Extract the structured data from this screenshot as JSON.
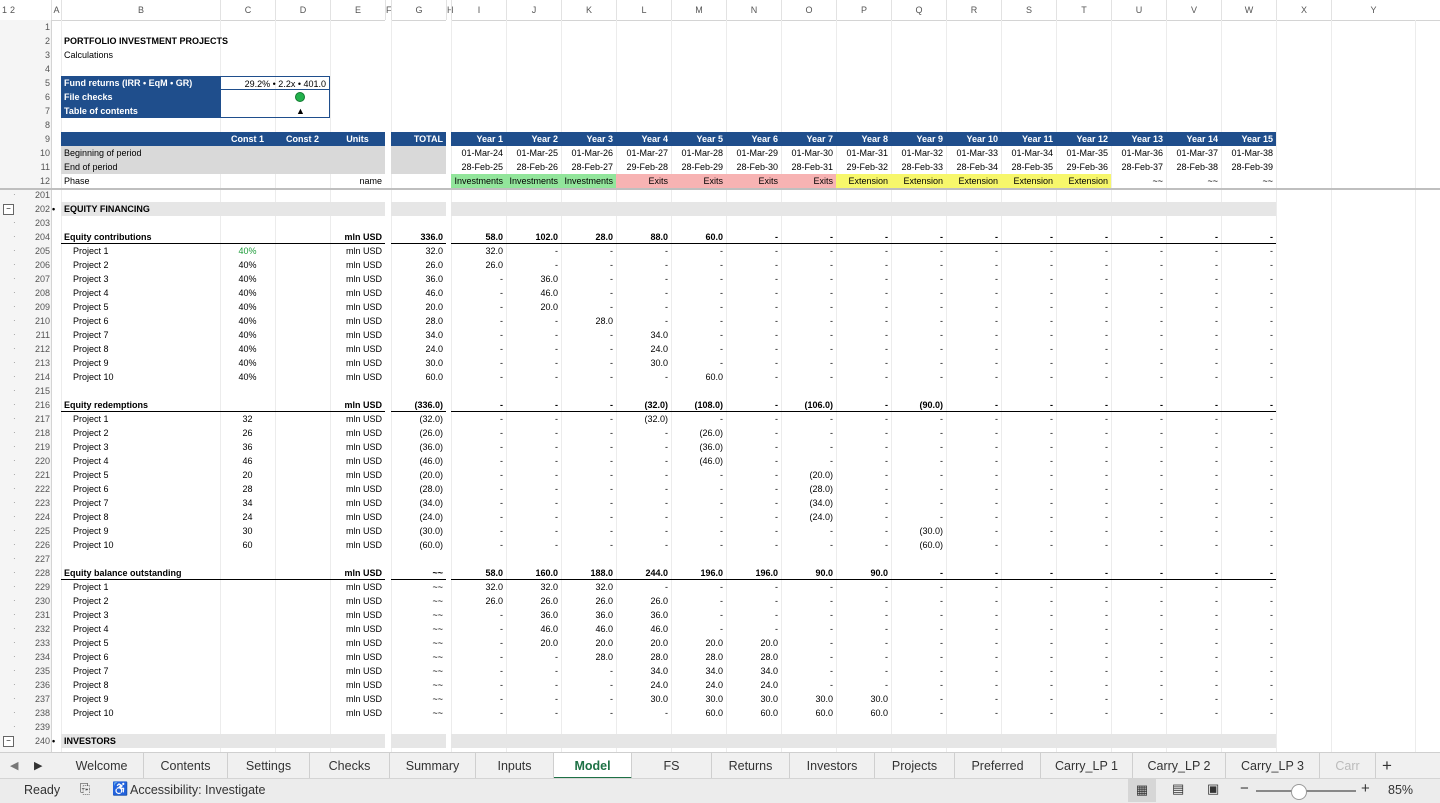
{
  "col_headers": [
    "A",
    "B",
    "C",
    "D",
    "E",
    "F",
    "G",
    "H",
    "I",
    "J",
    "K",
    "L",
    "M",
    "N",
    "O",
    "P",
    "Q",
    "R",
    "S",
    "T",
    "U",
    "V",
    "W",
    "X",
    "Y"
  ],
  "outline_levels": [
    "1",
    "2"
  ],
  "top": {
    "title": "PORTFOLIO INVESTMENT PROJECTS",
    "subtitle": "Calculations",
    "fund_label": "Fund returns (IRR • EqM • GR)",
    "fund_value": "29.2% • 2.2x • 401.0",
    "checks_label": "File checks",
    "toc_label": "Table of contents",
    "toc_glyph": "▲",
    "check_color": "#22b14c"
  },
  "header": {
    "const1": "Const 1",
    "const2": "Const 2",
    "units": "Units",
    "total": "TOTAL",
    "years": [
      "Year 1",
      "Year 2",
      "Year 3",
      "Year 4",
      "Year 5",
      "Year 6",
      "Year 7",
      "Year 8",
      "Year 9",
      "Year 10",
      "Year 11",
      "Year 12",
      "Year 13",
      "Year 14",
      "Year 15"
    ],
    "bop_label": "Beginning of period",
    "bop": [
      "01-Mar-24",
      "01-Mar-25",
      "01-Mar-26",
      "01-Mar-27",
      "01-Mar-28",
      "01-Mar-29",
      "01-Mar-30",
      "01-Mar-31",
      "01-Mar-32",
      "01-Mar-33",
      "01-Mar-34",
      "01-Mar-35",
      "01-Mar-36",
      "01-Mar-37",
      "01-Mar-38"
    ],
    "eop_label": "End of period",
    "eop": [
      "28-Feb-25",
      "28-Feb-26",
      "28-Feb-27",
      "29-Feb-28",
      "28-Feb-29",
      "28-Feb-30",
      "28-Feb-31",
      "29-Feb-32",
      "28-Feb-33",
      "28-Feb-34",
      "28-Feb-35",
      "29-Feb-36",
      "28-Feb-37",
      "28-Feb-38",
      "28-Feb-39"
    ],
    "phase_label": "Phase",
    "phase_units": "name",
    "phases": [
      "Investments",
      "Investments",
      "Investments",
      "Exits",
      "Exits",
      "Exits",
      "Exits",
      "Extension",
      "Extension",
      "Extension",
      "Extension",
      "Extension",
      "~~",
      "~~",
      "~~"
    ],
    "phase_types": [
      "inv",
      "inv",
      "inv",
      "exi",
      "exi",
      "exi",
      "exi",
      "ext",
      "ext",
      "ext",
      "ext",
      "ext",
      "",
      "",
      ""
    ]
  },
  "sections": [
    {
      "row": "202",
      "label": "EQUITY FINANCING",
      "bullet": "•"
    },
    {
      "row": "240",
      "label": "INVESTORS",
      "bullet": "•"
    }
  ],
  "blocks": [
    {
      "head": {
        "row": "204",
        "label": "Equity contributions",
        "units": "mln USD",
        "total": "336.0",
        "years": [
          "58.0",
          "102.0",
          "28.0",
          "88.0",
          "60.0",
          "-",
          "-",
          "-",
          "-",
          "-",
          "-",
          "-",
          "-",
          "-",
          "-"
        ]
      },
      "rows": [
        {
          "row": "205",
          "label": "Project 1",
          "c1": "40%",
          "c1green": true,
          "units": "mln USD",
          "total": "32.0",
          "years": [
            "32.0",
            "-",
            "-",
            "-",
            "-",
            "-",
            "-",
            "-",
            "-",
            "-",
            "-",
            "-",
            "-",
            "-",
            "-"
          ]
        },
        {
          "row": "206",
          "label": "Project 2",
          "c1": "40%",
          "units": "mln USD",
          "total": "26.0",
          "years": [
            "26.0",
            "-",
            "-",
            "-",
            "-",
            "-",
            "-",
            "-",
            "-",
            "-",
            "-",
            "-",
            "-",
            "-",
            "-"
          ]
        },
        {
          "row": "207",
          "label": "Project 3",
          "c1": "40%",
          "units": "mln USD",
          "total": "36.0",
          "years": [
            "-",
            "36.0",
            "-",
            "-",
            "-",
            "-",
            "-",
            "-",
            "-",
            "-",
            "-",
            "-",
            "-",
            "-",
            "-"
          ]
        },
        {
          "row": "208",
          "label": "Project 4",
          "c1": "40%",
          "units": "mln USD",
          "total": "46.0",
          "years": [
            "-",
            "46.0",
            "-",
            "-",
            "-",
            "-",
            "-",
            "-",
            "-",
            "-",
            "-",
            "-",
            "-",
            "-",
            "-"
          ]
        },
        {
          "row": "209",
          "label": "Project 5",
          "c1": "40%",
          "units": "mln USD",
          "total": "20.0",
          "years": [
            "-",
            "20.0",
            "-",
            "-",
            "-",
            "-",
            "-",
            "-",
            "-",
            "-",
            "-",
            "-",
            "-",
            "-",
            "-"
          ]
        },
        {
          "row": "210",
          "label": "Project 6",
          "c1": "40%",
          "units": "mln USD",
          "total": "28.0",
          "years": [
            "-",
            "-",
            "28.0",
            "-",
            "-",
            "-",
            "-",
            "-",
            "-",
            "-",
            "-",
            "-",
            "-",
            "-",
            "-"
          ]
        },
        {
          "row": "211",
          "label": "Project 7",
          "c1": "40%",
          "units": "mln USD",
          "total": "34.0",
          "years": [
            "-",
            "-",
            "-",
            "34.0",
            "-",
            "-",
            "-",
            "-",
            "-",
            "-",
            "-",
            "-",
            "-",
            "-",
            "-"
          ]
        },
        {
          "row": "212",
          "label": "Project 8",
          "c1": "40%",
          "units": "mln USD",
          "total": "24.0",
          "years": [
            "-",
            "-",
            "-",
            "24.0",
            "-",
            "-",
            "-",
            "-",
            "-",
            "-",
            "-",
            "-",
            "-",
            "-",
            "-"
          ]
        },
        {
          "row": "213",
          "label": "Project 9",
          "c1": "40%",
          "units": "mln USD",
          "total": "30.0",
          "years": [
            "-",
            "-",
            "-",
            "30.0",
            "-",
            "-",
            "-",
            "-",
            "-",
            "-",
            "-",
            "-",
            "-",
            "-",
            "-"
          ]
        },
        {
          "row": "214",
          "label": "Project 10",
          "c1": "40%",
          "units": "mln USD",
          "total": "60.0",
          "years": [
            "-",
            "-",
            "-",
            "-",
            "60.0",
            "-",
            "-",
            "-",
            "-",
            "-",
            "-",
            "-",
            "-",
            "-",
            "-"
          ]
        }
      ]
    },
    {
      "head": {
        "row": "216",
        "label": "Equity redemptions",
        "units": "mln USD",
        "total": "(336.0)",
        "years": [
          "-",
          "-",
          "-",
          "(32.0)",
          "(108.0)",
          "-",
          "(106.0)",
          "-",
          "(90.0)",
          "-",
          "-",
          "-",
          "-",
          "-",
          "-"
        ]
      },
      "rows": [
        {
          "row": "217",
          "label": "Project 1",
          "c1": "32",
          "units": "mln USD",
          "total": "(32.0)",
          "years": [
            "-",
            "-",
            "-",
            "(32.0)",
            "-",
            "-",
            "-",
            "-",
            "-",
            "-",
            "-",
            "-",
            "-",
            "-",
            "-"
          ]
        },
        {
          "row": "218",
          "label": "Project 2",
          "c1": "26",
          "units": "mln USD",
          "total": "(26.0)",
          "years": [
            "-",
            "-",
            "-",
            "-",
            "(26.0)",
            "-",
            "-",
            "-",
            "-",
            "-",
            "-",
            "-",
            "-",
            "-",
            "-"
          ]
        },
        {
          "row": "219",
          "label": "Project 3",
          "c1": "36",
          "units": "mln USD",
          "total": "(36.0)",
          "years": [
            "-",
            "-",
            "-",
            "-",
            "(36.0)",
            "-",
            "-",
            "-",
            "-",
            "-",
            "-",
            "-",
            "-",
            "-",
            "-"
          ]
        },
        {
          "row": "220",
          "label": "Project 4",
          "c1": "46",
          "units": "mln USD",
          "total": "(46.0)",
          "years": [
            "-",
            "-",
            "-",
            "-",
            "(46.0)",
            "-",
            "-",
            "-",
            "-",
            "-",
            "-",
            "-",
            "-",
            "-",
            "-"
          ]
        },
        {
          "row": "221",
          "label": "Project 5",
          "c1": "20",
          "units": "mln USD",
          "total": "(20.0)",
          "years": [
            "-",
            "-",
            "-",
            "-",
            "-",
            "-",
            "(20.0)",
            "-",
            "-",
            "-",
            "-",
            "-",
            "-",
            "-",
            "-"
          ]
        },
        {
          "row": "222",
          "label": "Project 6",
          "c1": "28",
          "units": "mln USD",
          "total": "(28.0)",
          "years": [
            "-",
            "-",
            "-",
            "-",
            "-",
            "-",
            "(28.0)",
            "-",
            "-",
            "-",
            "-",
            "-",
            "-",
            "-",
            "-"
          ]
        },
        {
          "row": "223",
          "label": "Project 7",
          "c1": "34",
          "units": "mln USD",
          "total": "(34.0)",
          "years": [
            "-",
            "-",
            "-",
            "-",
            "-",
            "-",
            "(34.0)",
            "-",
            "-",
            "-",
            "-",
            "-",
            "-",
            "-",
            "-"
          ]
        },
        {
          "row": "224",
          "label": "Project 8",
          "c1": "24",
          "units": "mln USD",
          "total": "(24.0)",
          "years": [
            "-",
            "-",
            "-",
            "-",
            "-",
            "-",
            "(24.0)",
            "-",
            "-",
            "-",
            "-",
            "-",
            "-",
            "-",
            "-"
          ]
        },
        {
          "row": "225",
          "label": "Project 9",
          "c1": "30",
          "units": "mln USD",
          "total": "(30.0)",
          "years": [
            "-",
            "-",
            "-",
            "-",
            "-",
            "-",
            "-",
            "-",
            "(30.0)",
            "-",
            "-",
            "-",
            "-",
            "-",
            "-"
          ]
        },
        {
          "row": "226",
          "label": "Project 10",
          "c1": "60",
          "units": "mln USD",
          "total": "(60.0)",
          "years": [
            "-",
            "-",
            "-",
            "-",
            "-",
            "-",
            "-",
            "-",
            "(60.0)",
            "-",
            "-",
            "-",
            "-",
            "-",
            "-"
          ]
        }
      ]
    },
    {
      "head": {
        "row": "228",
        "label": "Equity balance outstanding",
        "units": "mln USD",
        "total": "~~",
        "years": [
          "58.0",
          "160.0",
          "188.0",
          "244.0",
          "196.0",
          "196.0",
          "90.0",
          "90.0",
          "-",
          "-",
          "-",
          "-",
          "-",
          "-",
          "-"
        ]
      },
      "rows": [
        {
          "row": "229",
          "label": "Project 1",
          "c1": "",
          "units": "mln USD",
          "total": "~~",
          "years": [
            "32.0",
            "32.0",
            "32.0",
            "-",
            "-",
            "-",
            "-",
            "-",
            "-",
            "-",
            "-",
            "-",
            "-",
            "-",
            "-"
          ]
        },
        {
          "row": "230",
          "label": "Project 2",
          "c1": "",
          "units": "mln USD",
          "total": "~~",
          "years": [
            "26.0",
            "26.0",
            "26.0",
            "26.0",
            "-",
            "-",
            "-",
            "-",
            "-",
            "-",
            "-",
            "-",
            "-",
            "-",
            "-"
          ]
        },
        {
          "row": "231",
          "label": "Project 3",
          "c1": "",
          "units": "mln USD",
          "total": "~~",
          "years": [
            "-",
            "36.0",
            "36.0",
            "36.0",
            "-",
            "-",
            "-",
            "-",
            "-",
            "-",
            "-",
            "-",
            "-",
            "-",
            "-"
          ]
        },
        {
          "row": "232",
          "label": "Project 4",
          "c1": "",
          "units": "mln USD",
          "total": "~~",
          "years": [
            "-",
            "46.0",
            "46.0",
            "46.0",
            "-",
            "-",
            "-",
            "-",
            "-",
            "-",
            "-",
            "-",
            "-",
            "-",
            "-"
          ]
        },
        {
          "row": "233",
          "label": "Project 5",
          "c1": "",
          "units": "mln USD",
          "total": "~~",
          "years": [
            "-",
            "20.0",
            "20.0",
            "20.0",
            "20.0",
            "20.0",
            "-",
            "-",
            "-",
            "-",
            "-",
            "-",
            "-",
            "-",
            "-"
          ]
        },
        {
          "row": "234",
          "label": "Project 6",
          "c1": "",
          "units": "mln USD",
          "total": "~~",
          "years": [
            "-",
            "-",
            "28.0",
            "28.0",
            "28.0",
            "28.0",
            "-",
            "-",
            "-",
            "-",
            "-",
            "-",
            "-",
            "-",
            "-"
          ]
        },
        {
          "row": "235",
          "label": "Project 7",
          "c1": "",
          "units": "mln USD",
          "total": "~~",
          "years": [
            "-",
            "-",
            "-",
            "34.0",
            "34.0",
            "34.0",
            "-",
            "-",
            "-",
            "-",
            "-",
            "-",
            "-",
            "-",
            "-"
          ]
        },
        {
          "row": "236",
          "label": "Project 8",
          "c1": "",
          "units": "mln USD",
          "total": "~~",
          "years": [
            "-",
            "-",
            "-",
            "24.0",
            "24.0",
            "24.0",
            "-",
            "-",
            "-",
            "-",
            "-",
            "-",
            "-",
            "-",
            "-"
          ]
        },
        {
          "row": "237",
          "label": "Project 9",
          "c1": "",
          "units": "mln USD",
          "total": "~~",
          "years": [
            "-",
            "-",
            "-",
            "30.0",
            "30.0",
            "30.0",
            "30.0",
            "30.0",
            "-",
            "-",
            "-",
            "-",
            "-",
            "-",
            "-"
          ]
        },
        {
          "row": "238",
          "label": "Project 10",
          "c1": "",
          "units": "mln USD",
          "total": "~~",
          "years": [
            "-",
            "-",
            "-",
            "-",
            "60.0",
            "60.0",
            "60.0",
            "60.0",
            "-",
            "-",
            "-",
            "-",
            "-",
            "-",
            "-"
          ]
        }
      ]
    }
  ],
  "tabs": [
    "Welcome",
    "Contents",
    "Settings",
    "Checks",
    "Summary",
    "Inputs",
    "Model",
    "FS",
    "Returns",
    "Investors",
    "Projects",
    "Preferred",
    "Carry_LP 1",
    "Carry_LP 2",
    "Carry_LP 3",
    "Carr"
  ],
  "active_tab": "Model",
  "status": {
    "ready": "Ready",
    "accessibility": "Accessibility: Investigate",
    "zoom": "85%"
  }
}
